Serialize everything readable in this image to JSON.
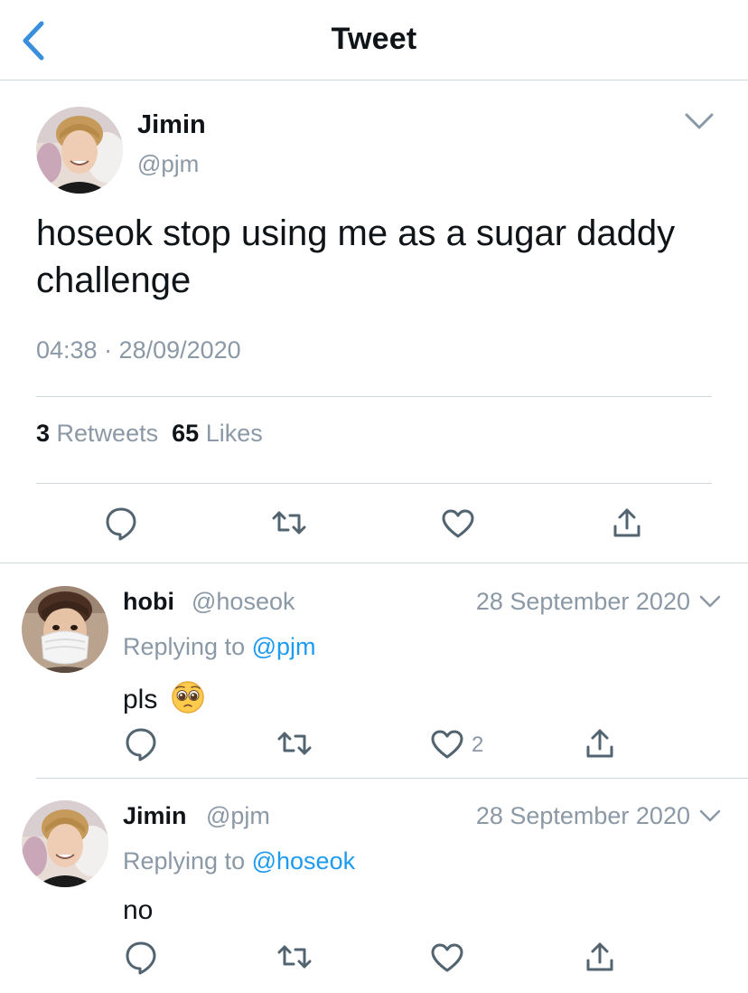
{
  "header": {
    "title": "Tweet",
    "back_icon": "chevron-left-icon"
  },
  "main_tweet": {
    "name": "Jimin",
    "handle": "@pjm",
    "text": "hoseok stop using me as a sugar daddy challenge",
    "time": "04:38 · 28/09/2020",
    "retweets_count": "3",
    "retweets_label": "Retweets",
    "likes_count": "65",
    "likes_label": "Likes"
  },
  "replies": [
    {
      "name": "hobi",
      "handle": "@hoseok",
      "date": "28 September 2020",
      "replying_prefix": "Replying to",
      "replying_to": "@pjm",
      "text": "pls",
      "emoji": "🥺",
      "like_count": "2"
    },
    {
      "name": "Jimin",
      "handle": "@pjm",
      "date": "28 September 2020",
      "replying_prefix": "Replying to",
      "replying_to": "@hoseok",
      "text": "no",
      "like_count": ""
    }
  ],
  "colors": {
    "accent": "#1d9bf0",
    "secondary_text": "#8b98a5",
    "divider": "#cfd9de",
    "icon": "#536471"
  }
}
